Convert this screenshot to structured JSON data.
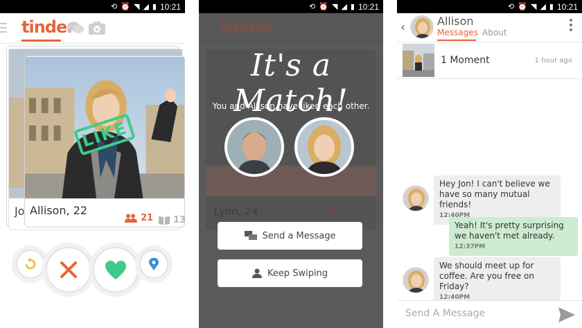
{
  "status_bar": {
    "time": "10:21"
  },
  "colors": {
    "accent": "#e8623a",
    "like_green": "#3ecb8b",
    "outgoing_bubble": "#cdebd0",
    "incoming_bubble": "#eeeeee"
  },
  "swipe_screen": {
    "logo": "tinder",
    "like_stamp": "LIKE",
    "card": {
      "name": "Allison, 22",
      "mutual_friends": "21",
      "shared_interests": "13"
    },
    "back_card_name": "Jo",
    "icons": [
      "menu-icon",
      "chat-icon",
      "camera-icon",
      "undo-icon",
      "dislike-icon",
      "like-icon",
      "location-icon"
    ]
  },
  "match_screen": {
    "title": "It's a Match!",
    "subtitle": "You and Allison have liked each other.",
    "background_card_name": "Lynn, 24",
    "background_friends": "18",
    "send_message_label": "Send a Message",
    "keep_swiping_label": "Keep Swiping"
  },
  "chat_screen": {
    "contact_name": "Allison",
    "tabs": [
      {
        "label": "Messages",
        "active": true
      },
      {
        "label": "About",
        "active": false
      }
    ],
    "moment": {
      "label": "1 Moment",
      "time": "1 hour ago"
    },
    "messages": [
      {
        "direction": "incoming",
        "text": "Hey Jon! I can't believe we have so many mutual friends!",
        "time": "12:40PM"
      },
      {
        "direction": "outgoing",
        "text": "Yeah! It's pretty surprising we haven't met already.",
        "time": "12:37PM"
      },
      {
        "direction": "incoming",
        "text": "We should meet up for coffee. Are you free on Friday?",
        "time": "12:40PM"
      }
    ],
    "compose_placeholder": "Send A Message"
  }
}
